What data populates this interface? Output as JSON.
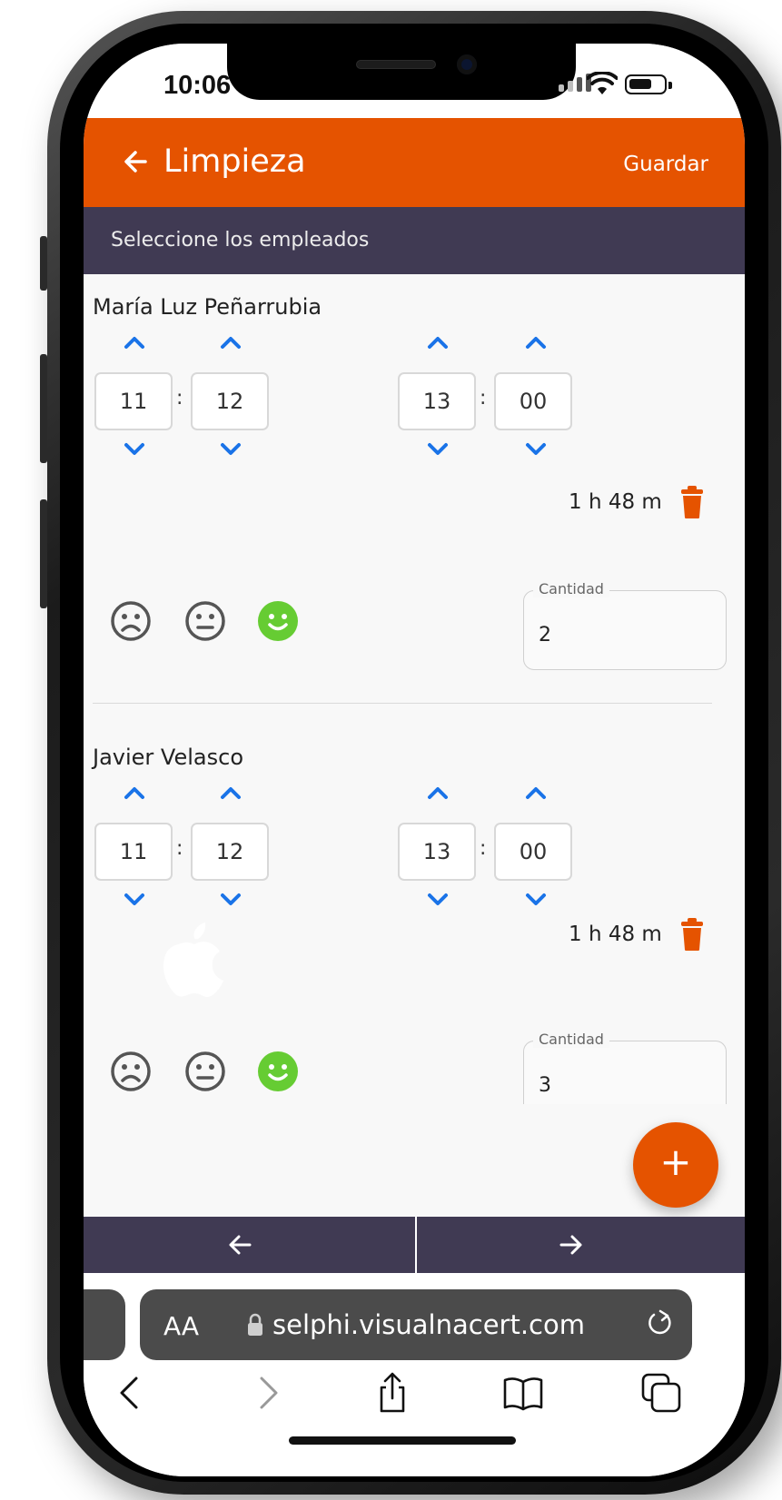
{
  "status_bar": {
    "time": "10:06"
  },
  "header": {
    "title": "Limpieza",
    "save_label": "Guardar"
  },
  "subheader": {
    "text": "Seleccione los empleados"
  },
  "employees": [
    {
      "name": "María Luz Peñarrubia",
      "start_hour": "11",
      "start_minute": "12",
      "end_hour": "13",
      "end_minute": "00",
      "duration": "1 h 48 m",
      "quantity_label": "Cantidad",
      "quantity": "2",
      "selected_mood": "happy"
    },
    {
      "name": "Javier Velasco",
      "start_hour": "11",
      "start_minute": "12",
      "end_hour": "13",
      "end_minute": "00",
      "duration": "1 h 48 m",
      "quantity_label": "Cantidad",
      "quantity": "3",
      "selected_mood": "happy"
    }
  ],
  "fab": {
    "label": "+"
  },
  "browser": {
    "text_size": "AA",
    "url": "selphi.visualnacert.com"
  },
  "colors": {
    "accent": "#e55300",
    "dark": "#403a53",
    "happy": "#66cc33",
    "arrow": "#1a73e8"
  },
  "icons": [
    "back-arrow-icon",
    "chevron-up-icon",
    "chevron-down-icon",
    "trash-icon",
    "sad-face-icon",
    "neutral-face-icon",
    "happy-face-icon",
    "plus-icon",
    "arrow-left-icon",
    "arrow-right-icon",
    "lock-icon",
    "reload-icon",
    "share-icon",
    "bookmarks-icon",
    "tabs-icon"
  ]
}
